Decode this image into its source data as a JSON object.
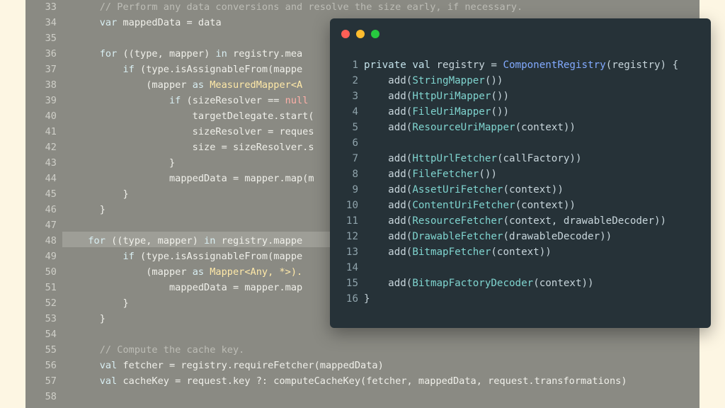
{
  "background_editor": {
    "lines": [
      {
        "num": "33",
        "segments": [
          {
            "t": "    // Perform any data conversions and resolve the size early, if necessary.",
            "cls": "c"
          }
        ]
      },
      {
        "num": "34",
        "segments": [
          {
            "t": "    ",
            "cls": ""
          },
          {
            "t": "var",
            "cls": "k"
          },
          {
            "t": " mappedData = data",
            "cls": ""
          }
        ]
      },
      {
        "num": "35",
        "segments": []
      },
      {
        "num": "36",
        "segments": [
          {
            "t": "    ",
            "cls": ""
          },
          {
            "t": "for",
            "cls": "k"
          },
          {
            "t": " ((type, mapper) ",
            "cls": ""
          },
          {
            "t": "in",
            "cls": "k"
          },
          {
            "t": " registry.mea",
            "cls": ""
          }
        ]
      },
      {
        "num": "37",
        "segments": [
          {
            "t": "        ",
            "cls": ""
          },
          {
            "t": "if",
            "cls": "k"
          },
          {
            "t": " (type.isAssignableFrom(mappe",
            "cls": ""
          }
        ]
      },
      {
        "num": "38",
        "segments": [
          {
            "t": "            (mapper ",
            "cls": ""
          },
          {
            "t": "as",
            "cls": "k"
          },
          {
            "t": " MeasuredMapper<A",
            "cls": "s"
          }
        ]
      },
      {
        "num": "39",
        "segments": [
          {
            "t": "                ",
            "cls": ""
          },
          {
            "t": "if",
            "cls": "k"
          },
          {
            "t": " (sizeResolver == ",
            "cls": ""
          },
          {
            "t": "null",
            "cls": "r"
          }
        ]
      },
      {
        "num": "40",
        "segments": [
          {
            "t": "                    targetDelegate.start(",
            "cls": ""
          }
        ]
      },
      {
        "num": "41",
        "segments": [
          {
            "t": "                    sizeResolver = reques",
            "cls": ""
          }
        ]
      },
      {
        "num": "42",
        "segments": [
          {
            "t": "                    size = sizeResolver.s",
            "cls": ""
          }
        ]
      },
      {
        "num": "43",
        "segments": [
          {
            "t": "                }",
            "cls": ""
          }
        ]
      },
      {
        "num": "44",
        "segments": [
          {
            "t": "                mappedData = mapper.map(m",
            "cls": ""
          }
        ]
      },
      {
        "num": "45",
        "segments": [
          {
            "t": "        }",
            "cls": ""
          }
        ]
      },
      {
        "num": "46",
        "segments": [
          {
            "t": "    }",
            "cls": ""
          }
        ]
      },
      {
        "num": "47",
        "segments": []
      },
      {
        "num": "48",
        "segments": [
          {
            "t": "  ",
            "cls": ""
          },
          {
            "t": "for",
            "cls": "k"
          },
          {
            "t": " ((type, mapper) ",
            "cls": ""
          },
          {
            "t": "in",
            "cls": "k"
          },
          {
            "t": " registry.mappe",
            "cls": ""
          }
        ]
      },
      {
        "num": "49",
        "segments": [
          {
            "t": "        ",
            "cls": ""
          },
          {
            "t": "if",
            "cls": "k"
          },
          {
            "t": " (type.isAssignableFrom(mappe",
            "cls": ""
          }
        ]
      },
      {
        "num": "50",
        "segments": [
          {
            "t": "            (mapper ",
            "cls": ""
          },
          {
            "t": "as",
            "cls": "k"
          },
          {
            "t": " Mapper<Any, *>).",
            "cls": "s"
          }
        ]
      },
      {
        "num": "51",
        "segments": [
          {
            "t": "                mappedData = mapper.map",
            "cls": ""
          }
        ]
      },
      {
        "num": "52",
        "segments": [
          {
            "t": "        }",
            "cls": ""
          }
        ]
      },
      {
        "num": "53",
        "segments": [
          {
            "t": "    }",
            "cls": ""
          }
        ]
      },
      {
        "num": "54",
        "segments": []
      },
      {
        "num": "55",
        "segments": [
          {
            "t": "    // Compute the cache key.",
            "cls": "c"
          }
        ]
      },
      {
        "num": "56",
        "segments": [
          {
            "t": "    ",
            "cls": ""
          },
          {
            "t": "val",
            "cls": "k"
          },
          {
            "t": " fetcher = registry.requireFetcher(mappedData)",
            "cls": ""
          }
        ]
      },
      {
        "num": "57",
        "segments": [
          {
            "t": "    ",
            "cls": ""
          },
          {
            "t": "val",
            "cls": "k"
          },
          {
            "t": " cacheKey = request.key ?: computeCacheKey(fetcher, mappedData, request.transformations)",
            "cls": ""
          }
        ]
      },
      {
        "num": "58",
        "segments": []
      }
    ]
  },
  "snippet_window": {
    "lines": [
      {
        "num": "1",
        "segments": [
          {
            "t": "private val",
            "cls": "kw"
          },
          {
            "t": " registry = ",
            "cls": ""
          },
          {
            "t": "ComponentRegistry",
            "cls": "fn"
          },
          {
            "t": "(registry) {",
            "cls": ""
          }
        ]
      },
      {
        "num": "2",
        "segments": [
          {
            "t": "    add(",
            "cls": ""
          },
          {
            "t": "StringMapper",
            "cls": "ty"
          },
          {
            "t": "())",
            "cls": ""
          }
        ]
      },
      {
        "num": "3",
        "segments": [
          {
            "t": "    add(",
            "cls": ""
          },
          {
            "t": "HttpUriMapper",
            "cls": "ty"
          },
          {
            "t": "())",
            "cls": ""
          }
        ]
      },
      {
        "num": "4",
        "segments": [
          {
            "t": "    add(",
            "cls": ""
          },
          {
            "t": "FileUriMapper",
            "cls": "ty"
          },
          {
            "t": "())",
            "cls": ""
          }
        ]
      },
      {
        "num": "5",
        "segments": [
          {
            "t": "    add(",
            "cls": ""
          },
          {
            "t": "ResourceUriMapper",
            "cls": "ty"
          },
          {
            "t": "(context))",
            "cls": ""
          }
        ]
      },
      {
        "num": "6",
        "segments": []
      },
      {
        "num": "7",
        "segments": [
          {
            "t": "    add(",
            "cls": ""
          },
          {
            "t": "HttpUrlFetcher",
            "cls": "ty"
          },
          {
            "t": "(callFactory))",
            "cls": ""
          }
        ]
      },
      {
        "num": "8",
        "segments": [
          {
            "t": "    add(",
            "cls": ""
          },
          {
            "t": "FileFetcher",
            "cls": "ty"
          },
          {
            "t": "())",
            "cls": ""
          }
        ]
      },
      {
        "num": "9",
        "segments": [
          {
            "t": "    add(",
            "cls": ""
          },
          {
            "t": "AssetUriFetcher",
            "cls": "ty"
          },
          {
            "t": "(context))",
            "cls": ""
          }
        ]
      },
      {
        "num": "10",
        "segments": [
          {
            "t": "    add(",
            "cls": ""
          },
          {
            "t": "ContentUriFetcher",
            "cls": "ty"
          },
          {
            "t": "(context))",
            "cls": ""
          }
        ]
      },
      {
        "num": "11",
        "segments": [
          {
            "t": "    add(",
            "cls": ""
          },
          {
            "t": "ResourceFetcher",
            "cls": "ty"
          },
          {
            "t": "(context, drawableDecoder))",
            "cls": ""
          }
        ]
      },
      {
        "num": "12",
        "segments": [
          {
            "t": "    add(",
            "cls": ""
          },
          {
            "t": "DrawableFetcher",
            "cls": "ty"
          },
          {
            "t": "(drawableDecoder))",
            "cls": ""
          }
        ]
      },
      {
        "num": "13",
        "segments": [
          {
            "t": "    add(",
            "cls": ""
          },
          {
            "t": "BitmapFetcher",
            "cls": "ty"
          },
          {
            "t": "(context))",
            "cls": ""
          }
        ]
      },
      {
        "num": "14",
        "segments": []
      },
      {
        "num": "15",
        "segments": [
          {
            "t": "    add(",
            "cls": ""
          },
          {
            "t": "BitmapFactoryDecoder",
            "cls": "ty"
          },
          {
            "t": "(context))",
            "cls": ""
          }
        ]
      },
      {
        "num": "16",
        "segments": [
          {
            "t": "}",
            "cls": ""
          }
        ]
      }
    ]
  }
}
